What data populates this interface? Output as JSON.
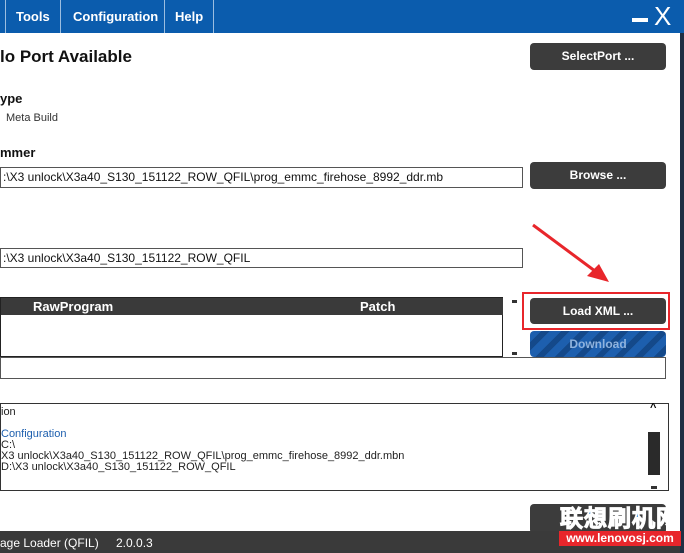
{
  "menu": {
    "items": [
      "Tools",
      "Configuration",
      "Help"
    ],
    "minimize": "_",
    "close": "X"
  },
  "port": {
    "status": "lo Port Available",
    "select_button": "SelectPort ..."
  },
  "build_type": {
    "label": "ype",
    "option": "Meta Build"
  },
  "programmer": {
    "label": "mmer",
    "path": ":\\X3 unlock\\X3a40_S130_151122_ROW_QFIL\\prog_emmc_firehose_8992_ddr.mb",
    "browse_button": "Browse ..."
  },
  "search_path": {
    "value": ":\\X3 unlock\\X3a40_S130_151122_ROW_QFIL"
  },
  "table": {
    "columns": [
      "RawProgram",
      "Patch"
    ]
  },
  "buttons": {
    "load_xml": "Load XML ...",
    "download": "Download"
  },
  "log": {
    "lines": [
      "ion",
      "",
      "Configuration",
      "C:\\",
      "X3 unlock\\X3a40_S130_151122_ROW_QFIL\\prog_emmc_firehose_8992_ddr.mbn",
      "D:\\X3 unlock\\X3a40_S130_151122_ROW_QFIL"
    ]
  },
  "status": {
    "app": "age Loader (QFIL)",
    "version": "2.0.0.3"
  },
  "watermark": {
    "title": "联想刷机网",
    "url": "www.lenovosj.com"
  },
  "colors": {
    "menubar": "#0b5cad",
    "button": "#3c3c3c",
    "highlight": "#e8262b",
    "download": "#1d5fae"
  }
}
